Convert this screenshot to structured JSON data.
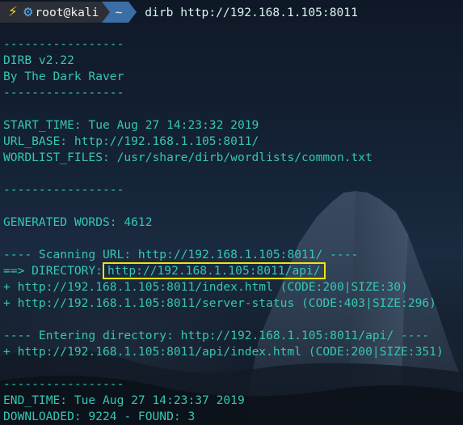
{
  "prompt": {
    "user": "root@kali",
    "dir": "~",
    "command": "dirb http://192.168.1.105:8011"
  },
  "icons": {
    "bolt": "lightning-bolt-icon",
    "gear": "gear-icon"
  },
  "colors": {
    "output_text": "#35c7b4",
    "highlight_box": "#f2e40b",
    "prompt_user_bg": "#2c2f36",
    "prompt_dir_bg": "#3b6ea5"
  },
  "output": {
    "sep1": "-----------------",
    "version": "DIRB v2.22",
    "author": "By The Dark Raver",
    "sep2": "-----------------",
    "start_time": "START_TIME: Tue Aug 27 14:23:32 2019",
    "url_base": "URL_BASE: http://192.168.1.105:8011/",
    "wordlist": "WORDLIST_FILES: /usr/share/dirb/wordlists/common.txt",
    "sep3": "-----------------",
    "generated": "GENERATED WORDS: 4612",
    "scanning": "---- Scanning URL: http://192.168.1.105:8011/ ----",
    "dir_prefix": "==> DIRECTORY:",
    "dir_url": "http://192.168.1.105:8011/api/",
    "found1": "+ http://192.168.1.105:8011/index.html (CODE:200|SIZE:30)",
    "found2": "+ http://192.168.1.105:8011/server-status (CODE:403|SIZE:296)",
    "entering": "---- Entering directory: http://192.168.1.105:8011/api/ ----",
    "found3": "+ http://192.168.1.105:8011/api/index.html (CODE:200|SIZE:351)",
    "sep4": "-----------------",
    "end_time": "END_TIME: Tue Aug 27 14:23:37 2019",
    "downloaded": "DOWNLOADED: 9224 - FOUND: 3"
  }
}
